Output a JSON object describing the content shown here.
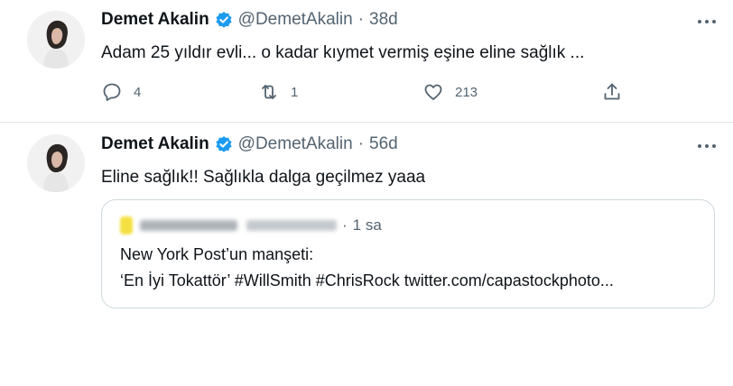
{
  "colors": {
    "verified": "#1d9bf0",
    "muted": "#536471",
    "text": "#0f1419",
    "border": "#cfd9de"
  },
  "tweets": [
    {
      "name": "Demet Akalin",
      "handle": "@DemetAkalin",
      "separator": "·",
      "time": "38d",
      "text": "Adam 25 yıldır evli... o kadar kıymet vermiş eşine eline sağlık ...",
      "actions": {
        "reply_icon": "comment-icon",
        "reply_count": "4",
        "retweet_icon": "retweet-icon",
        "retweet_count": "1",
        "like_icon": "heart-icon",
        "like_count": "213",
        "share_icon": "share-icon"
      }
    },
    {
      "name": "Demet Akalin",
      "handle": "@DemetAkalin",
      "separator": "·",
      "time": "56d",
      "text": "Eline sağlık!! Sağlıkla dalga geçilmez yaaa",
      "quote": {
        "separator": "·",
        "time": "1 sa",
        "line1": "New York Post’un manşeti:",
        "line2": "‘En İyi Tokattör’ #WillSmith #ChrisRock twitter.com/capastockphoto..."
      }
    }
  ]
}
